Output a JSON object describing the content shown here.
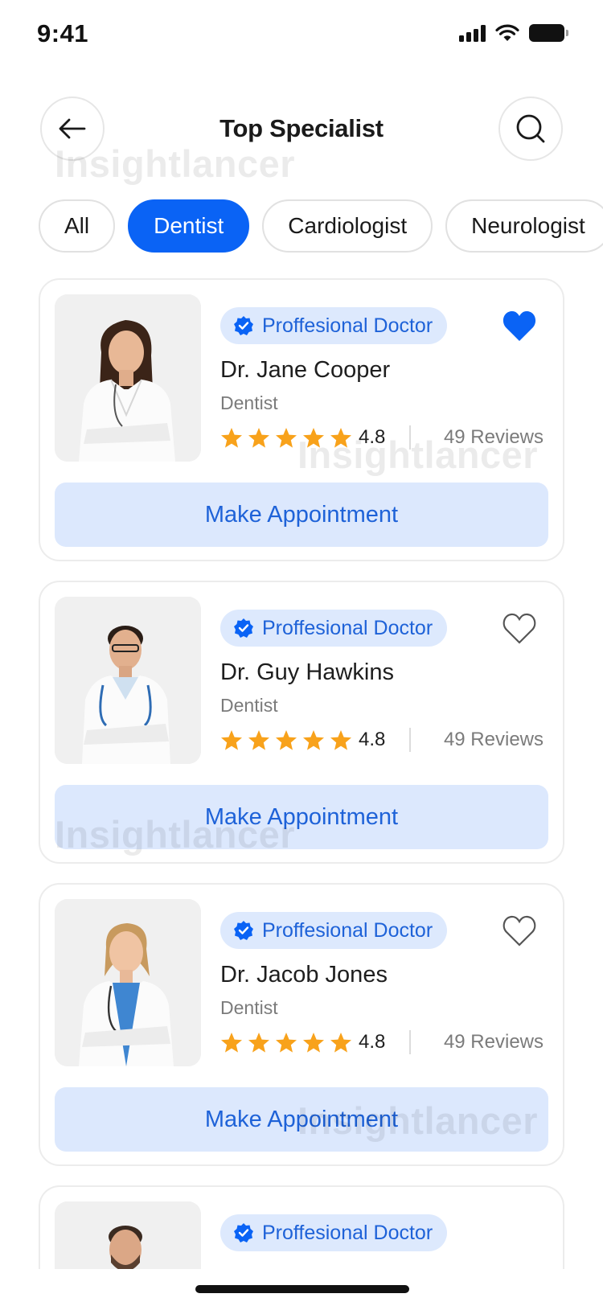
{
  "status_bar": {
    "time": "9:41"
  },
  "header": {
    "title": "Top Specialist"
  },
  "filters": {
    "chips": [
      "All",
      "Dentist",
      "Cardiologist",
      "Neurologist"
    ],
    "active": "Dentist"
  },
  "colors": {
    "accent": "#0A63F5",
    "badge_bg": "#DDE9FD",
    "star": "#F8A21B",
    "button_bg": "#DCE8FD"
  },
  "doctors": [
    {
      "badge": "Proffesional Doctor",
      "name": "Dr. Jane Cooper",
      "specialty": "Dentist",
      "rating": "4.8",
      "reviews": "49 Reviews",
      "favorite": true,
      "button": "Make Appointment"
    },
    {
      "badge": "Proffesional Doctor",
      "name": "Dr. Guy Hawkins",
      "specialty": "Dentist",
      "rating": "4.8",
      "reviews": "49 Reviews",
      "favorite": false,
      "button": "Make Appointment"
    },
    {
      "badge": "Proffesional Doctor",
      "name": "Dr. Jacob Jones",
      "specialty": "Dentist",
      "rating": "4.8",
      "reviews": "49 Reviews",
      "favorite": false,
      "button": "Make Appointment"
    },
    {
      "badge": "Proffesional Doctor"
    }
  ],
  "watermark": "Insightlancer"
}
